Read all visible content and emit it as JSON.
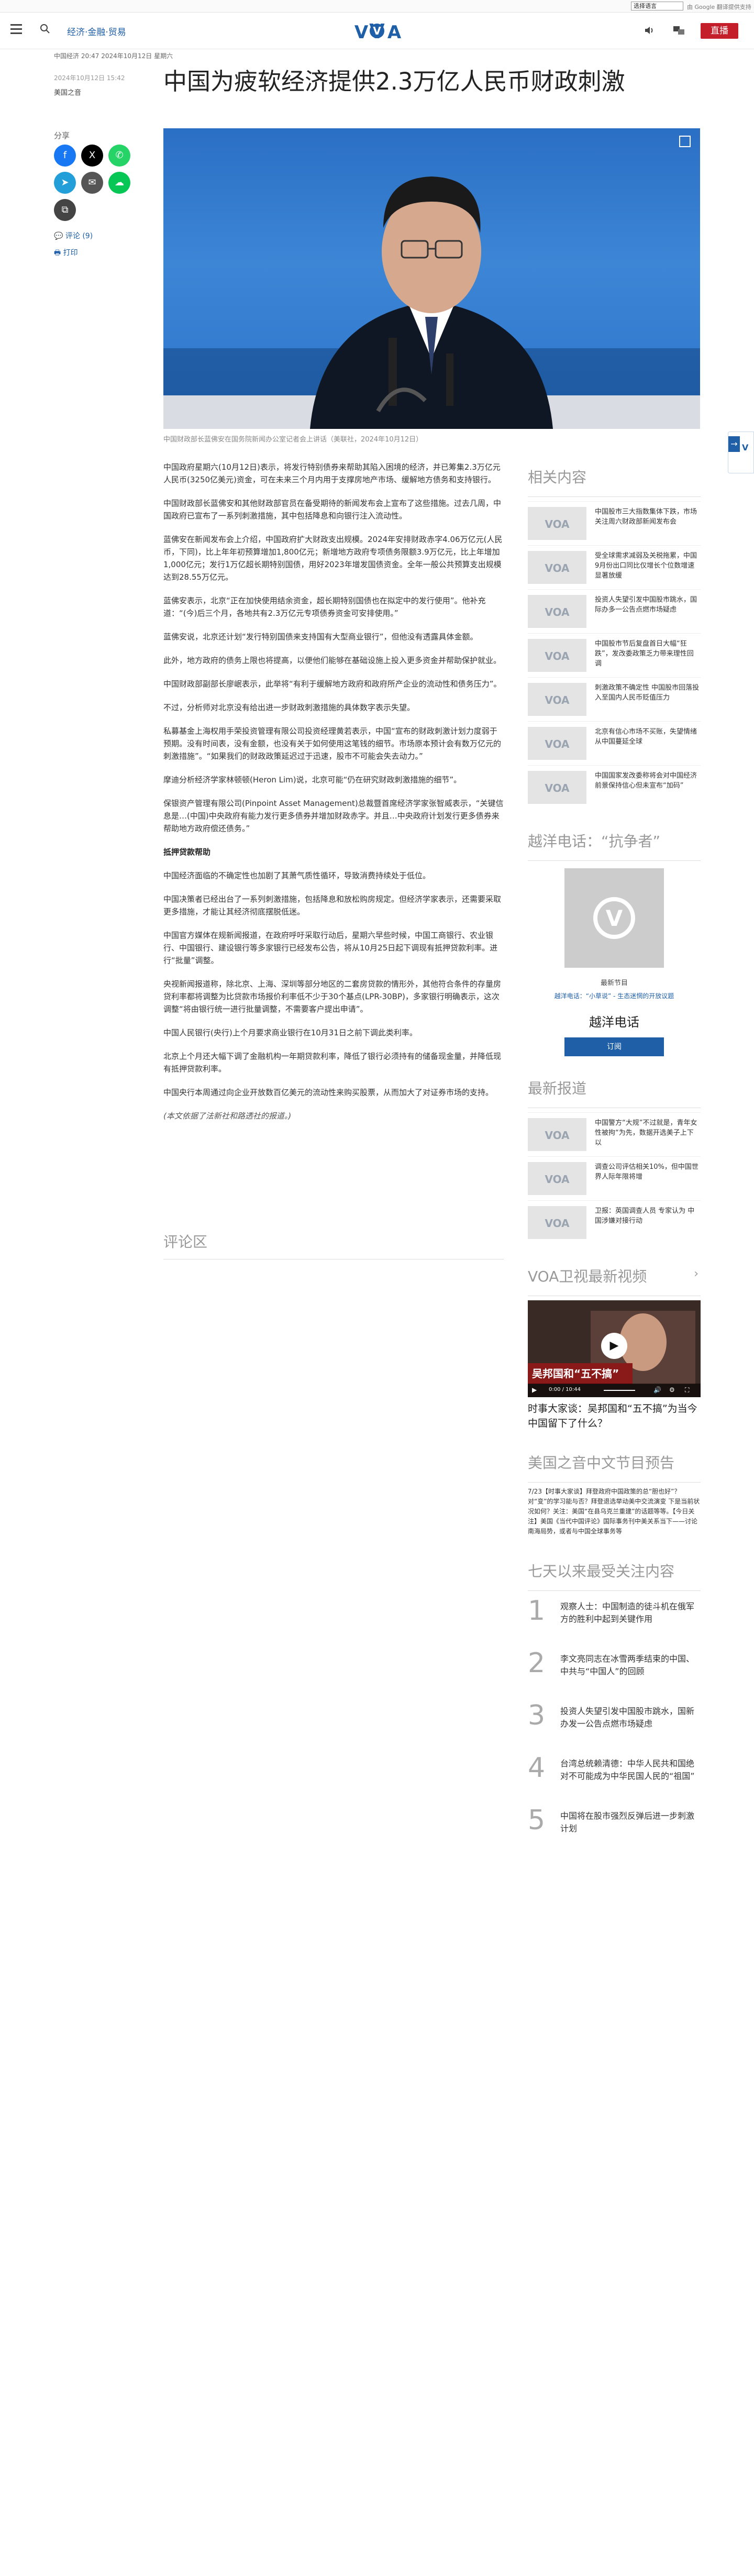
{
  "topbar": {
    "language_select": "选择语言",
    "google": "由 Google 翻译提供支持"
  },
  "header": {
    "nav": [
      "经济·金融·贸易"
    ],
    "live": "直播"
  },
  "article": {
    "meta": "中国经济 20:47 2024年10月12日 星期六",
    "date": "2024年10月12日 15:42",
    "source": "美国之音",
    "title": "中国为疲软经济提供2.3万亿人民币财政刺激",
    "share_label": "分享",
    "comments_label": "评论 (9)",
    "print_label": "打印",
    "caption": "中国财政部长蓝佛安在国务院新闻办公室记者会上讲话（美联社，2024年10月12日）",
    "paragraphs": [
      {
        "text": "中国政府星期六(10月12日)表示，将发行特别债券来帮助其陷入困境的经济，并已筹集2.3万亿元人民币(3250亿美元)资金，可在未来三个月内用于支撑房地产市场、缓解地方债务和支持银行。",
        "cls": ""
      },
      {
        "text": "中国财政部长蓝佛安和其他财政部官员在备受期待的新闻发布会上宣布了这些措施。过去几周，中国政府已宣布了一系列刺激措施，其中包括降息和向银行注入流动性。",
        "cls": ""
      },
      {
        "text": "蓝佛安在新闻发布会上介绍，中国政府扩大财政支出规模。2024年安排财政赤字4.06万亿元(人民币，下同)，比上年年初预算增加1,800亿元；新增地方政府专项债务限额3.9万亿元，比上年增加1,000亿元；发行1万亿超长期特别国债，用好2023年增发国债资金。全年一般公共预算支出规模达到28.55万亿元。",
        "cls": ""
      },
      {
        "text": "蓝佛安表示，北京“正在加快使用结余资金，超长期特别国债也在拟定中的发行使用”。他补充道：“(今)后三个月，各地共有2.3万亿元专项债券资金可安排使用。”",
        "cls": ""
      },
      {
        "text": "蓝佛安说，北京还计划“发行特别国债来支持国有大型商业银行”，但他没有透露具体金额。",
        "cls": ""
      },
      {
        "text": "此外，地方政府的债务上限也将提高，以便他们能够在基础设施上投入更多资金并帮助保护就业。",
        "cls": ""
      },
      {
        "text": "中国财政部副部长廖岷表示，此举将“有利于缓解地方政府和政府所产企业的流动性和债务压力”。",
        "cls": ""
      },
      {
        "text": "不过，分析师对北京没有给出进一步财政刺激措施的具体数字表示失望。",
        "cls": ""
      },
      {
        "text": "私募基金上海权用手荣投资管理有限公司投资经理黄若表示，中国“宣布的财政刺激计划力度弱于预期。没有时间表，没有金额，也没有关于如何使用这笔钱的细节。市场原本预计会有数万亿元的刺激措施”。“如果我们的财政政策延迟过于迅速，股市不可能会失去动力。”",
        "cls": ""
      },
      {
        "text": "摩迪分析经济学家林顿顿(Heron Lim)说，北京可能“仍在研究财政刺激措施的细节”。",
        "cls": ""
      },
      {
        "text": "保银资产管理有限公司(Pinpoint Asset Management)总裁暨首席经济学家张智威表示，“关键信息是…(中国)中央政府有能力发行更多债券并增加财政赤字。并且…中央政府计划发行更多债券来帮助地方政府偿还债务。”",
        "cls": ""
      },
      {
        "text": "抵押贷款帮助",
        "cls": "h"
      },
      {
        "text": "中国经济面临的不确定性也加剧了其萧气质性循环，导致消费持续处于低位。",
        "cls": ""
      },
      {
        "text": "中国决策者已经出台了一系列刺激措施，包括降息和放松购房规定。但经济学家表示，还需要采取更多措施，才能让其经济彻底摆脱低迷。",
        "cls": ""
      },
      {
        "text": "中国官方媒体在规新闻报道，在政府呼吁采取行动后，星期六早些时候，中国工商银行、农业银行、中国银行、建设银行等多家银行已经发布公告，将从10月25日起下调现有抵押贷款利率。进行“批量”调整。",
        "cls": ""
      },
      {
        "text": "央视新闻报道称，除北京、上海、深圳等部分地区的二套房贷款的情形外，其他符合条件的存量房贷利率都将调整为比贷款市场报价利率低不少于30个基点(LPR-30BP)，多家银行明确表示，这次调整“将由银行统一进行批量调整，不需要客户提出申请”。",
        "cls": ""
      },
      {
        "text": "中国人民银行(央行)上个月要求商业银行在10月31日之前下调此类利率。",
        "cls": ""
      },
      {
        "text": "北京上个月还大幅下调了金融机构一年期贷款利率，降低了银行必须持有的储备现金量，并降低现有抵押贷款利率。",
        "cls": ""
      },
      {
        "text": "中国央行本周通过向企业开放数百亿美元的流动性来购买股票，从而加大了对证券市场的支持。",
        "cls": ""
      },
      {
        "text": "(本文依据了法新社和路透社的报道。)",
        "cls": "n"
      }
    ],
    "comments_heading": "评论区"
  },
  "sidebar": {
    "related_heading": "相关内容",
    "related": [
      "中国股市三大指数集体下跌，市场关注周六财政部新闻发布会",
      "受全球需求减弱及关税拖累，中国9月份出口同比仅增长个位数增速显著放缓",
      "投资人失望引发中国股市跳水，国际办多一公告点燃市场疑虑",
      "中国股市节后复盘首日大幅“狂跌”，发改委政策乏力带来理性回调",
      "刺激政策不确定性 中国股市回落投入至国内人民币贬值压力",
      "北京有信心市场不买账，失望情绪从中国蔓延全球",
      "中国国家发改委称将会对中国经济前景保持信心但未宣布“加码”"
    ],
    "podcast_heading": "越洋电话：“抗争者”",
    "podcast_latest": "最新节目",
    "podcast_ep": "越洋电话：“小草说” - 生态迷惘的开放议题",
    "podcast_title": "越洋电话",
    "podcast_sub": "订阅",
    "latest_heading": "最新报道",
    "latest": [
      "中国警方“大规”不过就是，青年女性被拘“为先，数据开选美子上下以",
      "调查公司评估相关10%，但中国世界人际年限将增",
      "卫报：英国调查人员 专家认为 中国涉嫌对接行动"
    ],
    "video_heading": "VOA卫视最新视频",
    "video_overlay": "吴邦国和“五不搞”",
    "video_time": "0:00 / 10:44",
    "video_title": "时事大家谈：吴邦国和“五不搞”为当今中国留下了什么？",
    "program_heading": "美国之音中文节目预告",
    "program_text": "7/23【时事大家谈】拜登政府中国政策的总“胆也好”？对“变”的学习能与否？拜登退选举动美中交流演变 下是当前状况如何？关注：美国“在县乌克兰重建”的话题等等。【今日关注】美国《当代中国评论》国际事务刊中美关系当下——讨论南海局势，或者与中国全球事务等",
    "popular_heading": "七天以来最受关注内容",
    "popular": [
      "观察人士：中国制造的徒斗机在俄军方的胜利中起到关键作用",
      "李文亮同志在冰雪两季结束的中国、中共与“中国人”的回顾",
      "投资人失望引发中国股市跳水，国新办发一公告点燃市场疑虑",
      "台湾总统赖清德：中华人民共和国绝对不可能成为中华民国人民的“祖国”",
      "中国将在股市强烈反弹后进一步刺激计划"
    ]
  }
}
